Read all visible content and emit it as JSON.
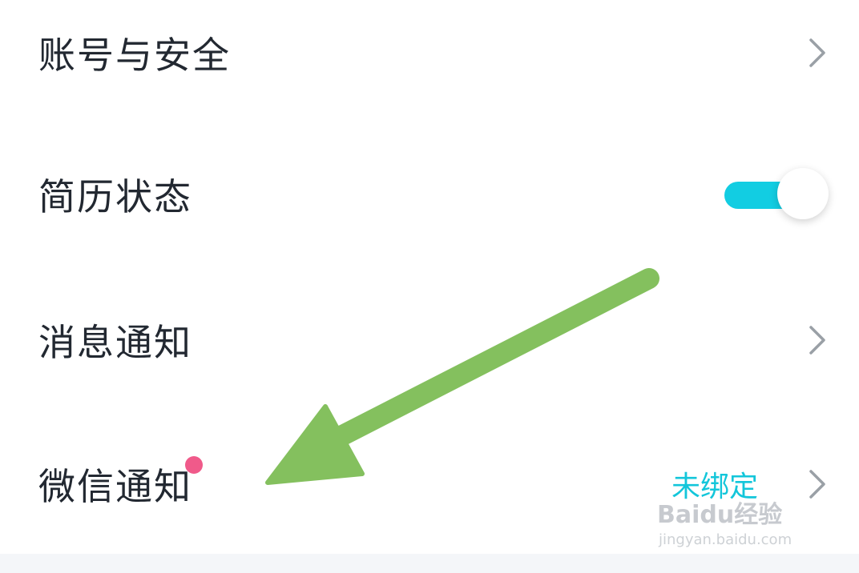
{
  "settings": {
    "items": [
      {
        "label": "账号与安全",
        "type": "link"
      },
      {
        "label": "简历状态",
        "type": "toggle",
        "enabled": true
      },
      {
        "label": "消息通知",
        "type": "link"
      },
      {
        "label": "微信通知",
        "type": "link",
        "status": "未绑定",
        "badge": true
      }
    ]
  },
  "colors": {
    "accent": "#12cde2",
    "badge": "#f05a8a",
    "arrow": "#84c05e",
    "status_text": "#13c6da"
  },
  "watermark": {
    "logo_text": "Baidu经验",
    "url": "jingyan.baidu.com"
  }
}
